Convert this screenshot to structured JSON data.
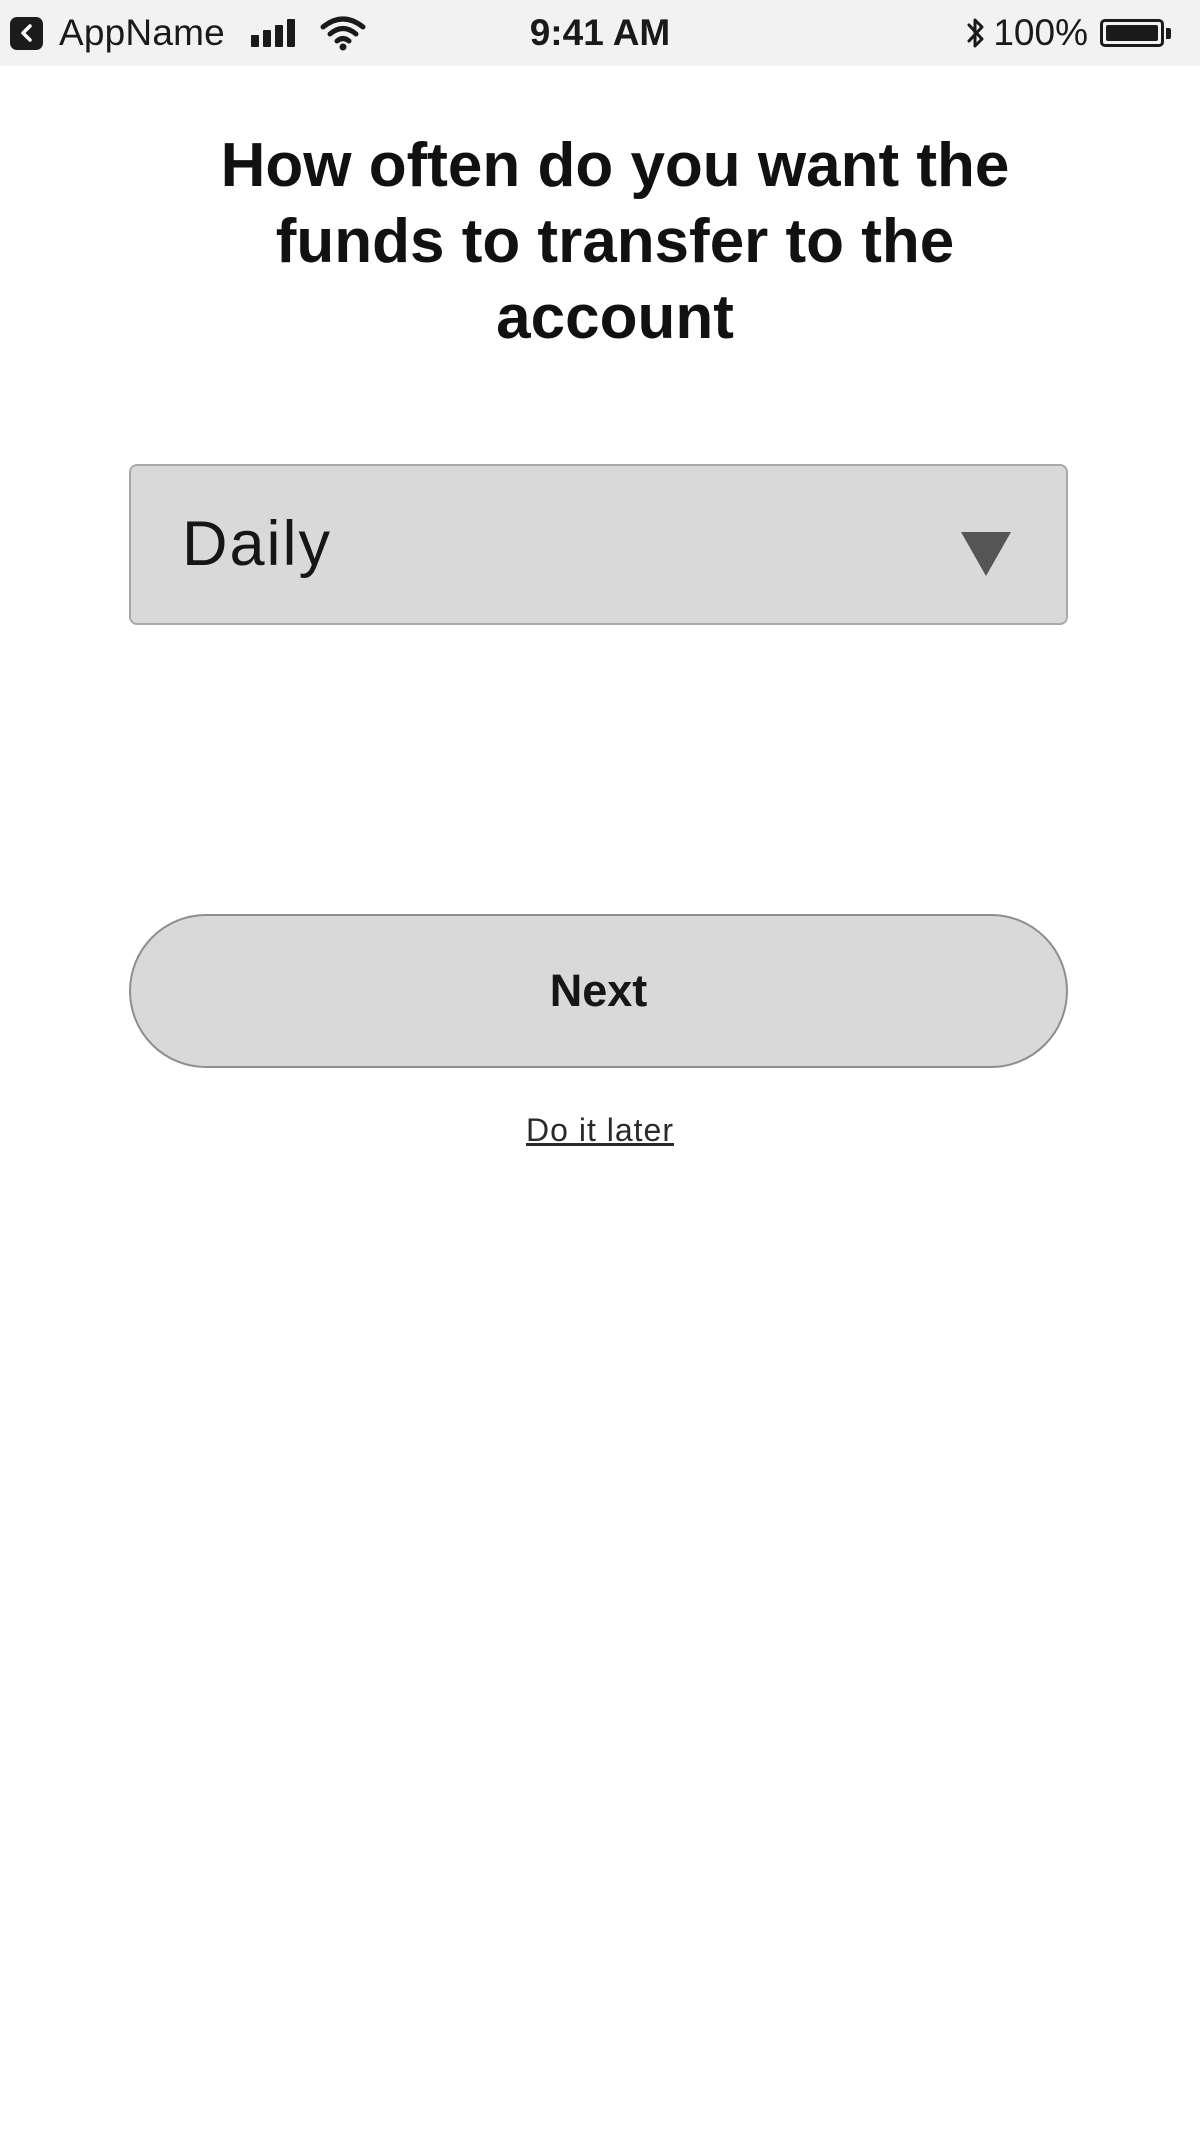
{
  "status_bar": {
    "app_name": "AppName",
    "time": "9:41 AM",
    "battery_percent": "100%",
    "battery_level": 1.0,
    "icons": [
      "back-to-app-icon",
      "signal-icon",
      "wifi-icon",
      "bluetooth-icon",
      "battery-icon"
    ]
  },
  "screen": {
    "question": "How often do you want the funds to transfer to the account",
    "frequency_select": {
      "selected_value": "Daily",
      "caret_icon": "triangle-down-icon"
    },
    "next_button_label": "Next",
    "do_it_later_label": "Do it later"
  },
  "colors": {
    "background": "#ffffff",
    "status_bar_background": "#f2f2f2",
    "control_background": "#d9d9d9",
    "text": "#111111",
    "caret": "#555555"
  }
}
